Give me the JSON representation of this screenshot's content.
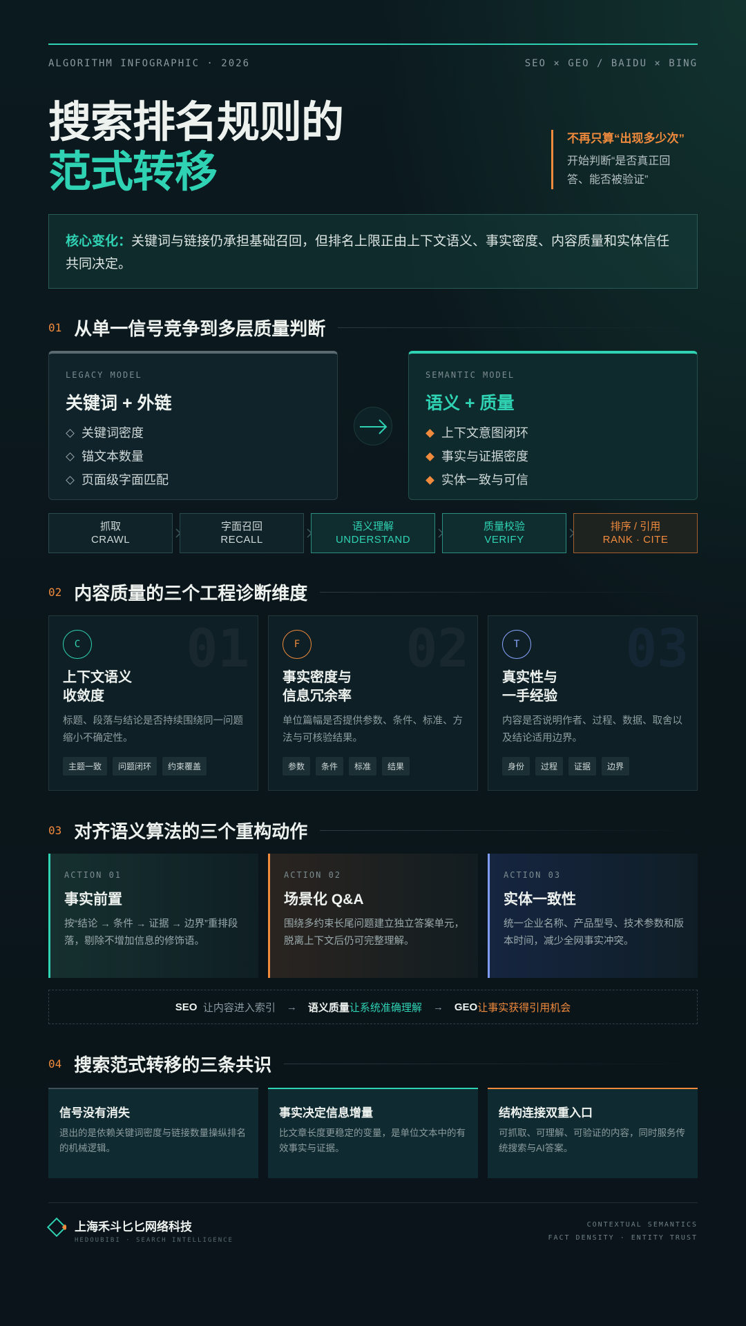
{
  "header": {
    "left": "ALGORITHM INFOGRAPHIC · 2026",
    "right": "SEO × GEO / BAIDU × BING"
  },
  "hero": {
    "line1": "搜索排名规则的",
    "line2": "范式转移"
  },
  "quote": {
    "highlight": "不再只算“出现多少次”",
    "body": "开始判断“是否真正回答、能否被验证”"
  },
  "core": {
    "key": "核心变化：",
    "text": "关键词与链接仍承担基础召回，但排名上限正由上下文语义、事实密度、内容质量和实体信任共同决定。"
  },
  "sections": [
    {
      "num": "01",
      "title": "从单一信号竞争到多层质量判断"
    },
    {
      "num": "02",
      "title": "内容质量的三个工程诊断维度"
    },
    {
      "num": "03",
      "title": "对齐语义算法的三个重构动作"
    },
    {
      "num": "04",
      "title": "搜索范式转移的三条共识"
    }
  ],
  "legacy": {
    "tag": "LEGACY MODEL",
    "title": "关键词 + 外链",
    "items": [
      "关键词密度",
      "锚文本数量",
      "页面级字面匹配"
    ]
  },
  "semantic": {
    "tag": "SEMANTIC MODEL",
    "title": "语义 + 质量",
    "items": [
      "上下文意图闭环",
      "事实与证据密度",
      "实体一致与可信"
    ]
  },
  "pipeline": [
    {
      "cn": "抓取",
      "en": "CRAWL",
      "style": "plain"
    },
    {
      "cn": "字面召回",
      "en": "RECALL",
      "style": "plain"
    },
    {
      "cn": "语义理解",
      "en": "UNDERSTAND",
      "style": "teal"
    },
    {
      "cn": "质量校验",
      "en": "VERIFY",
      "style": "teal"
    },
    {
      "cn": "排序 / 引用",
      "en": "RANK · CITE",
      "style": "orange"
    }
  ],
  "dimensions": [
    {
      "bg": "01",
      "badge": "C",
      "color": "#2fd3b4",
      "title1": "上下文语义",
      "title2": "收敛度",
      "desc": "标题、段落与结论是否持续围绕同一问题缩小不确定性。",
      "chips": [
        "主题一致",
        "问题闭环",
        "约束覆盖"
      ]
    },
    {
      "bg": "02",
      "badge": "F",
      "color": "#f08a3c",
      "title1": "事实密度与",
      "title2": "信息冗余率",
      "desc": "单位篇幅是否提供参数、条件、标准、方法与可核验结果。",
      "chips": [
        "参数",
        "条件",
        "标准",
        "结果"
      ]
    },
    {
      "bg": "03",
      "badge": "T",
      "color": "#8aa6ff",
      "title1": "真实性与",
      "title2": "一手经验",
      "desc": "内容是否说明作者、过程、数据、取舍以及结论适用边界。",
      "chips": [
        "身份",
        "过程",
        "证据",
        "边界"
      ]
    }
  ],
  "actions": [
    {
      "tag": "ACTION 01",
      "name": "事实前置",
      "desc": "按“结论 → 条件 → 证据 → 边界”重排段落，剔除不增加信息的修饰语。",
      "accent": "#2fd3b4"
    },
    {
      "tag": "ACTION 02",
      "name": "场景化 Q&A",
      "desc": "围绕多约束长尾问题建立独立答案单元，脱离上下文后仍可完整理解。",
      "accent": "#f08a3c"
    },
    {
      "tag": "ACTION 03",
      "name": "实体一致性",
      "desc": "统一企业名称、产品型号、技术参数和版本时间，减少全网事实冲突。",
      "accent": "#7f9cff"
    }
  ],
  "flow": {
    "seo_b": "SEO",
    "seo_t": "让内容进入索引",
    "q_b": "语义质量",
    "q_t": "让系统准确理解",
    "geo_b": "GEO",
    "geo_t": "让事实获得引用机会",
    "arrow": "→"
  },
  "consensus": [
    {
      "title": "信号没有消失",
      "desc": "退出的是依赖关键词密度与链接数量操纵排名的机械逻辑。",
      "accent": "#3f5056"
    },
    {
      "title": "事实决定信息增量",
      "desc": "比文章长度更稳定的变量，是单位文本中的有效事实与证据。",
      "accent": "#2fd3b4"
    },
    {
      "title": "结构连接双重入口",
      "desc": "可抓取、可理解、可验证的内容，同时服务传统搜索与AI答案。",
      "accent": "#f08a3c"
    }
  ],
  "footer": {
    "brand": "上海禾斗匕匕网络科技",
    "sub": "HEDOUBIBI · SEARCH INTELLIGENCE",
    "r1": "CONTEXTUAL SEMANTICS",
    "r2": "FACT DENSITY · ENTITY TRUST"
  }
}
